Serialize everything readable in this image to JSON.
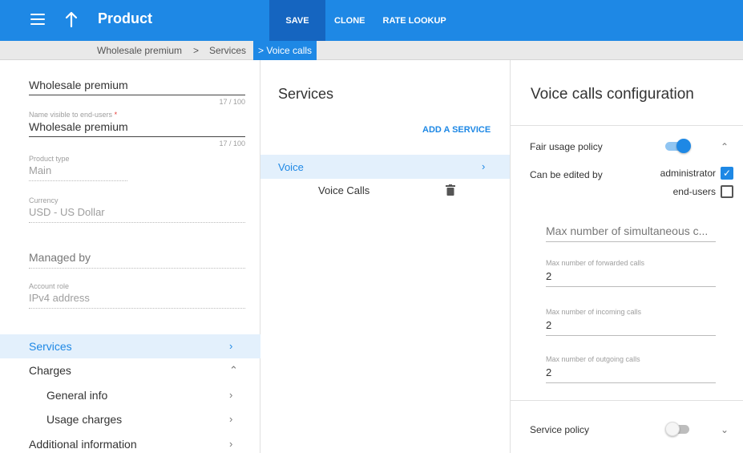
{
  "header": {
    "title": "Product",
    "save_label": "SAVE",
    "clone_label": "CLONE",
    "rate_lookup_label": "RATE LOOKUP"
  },
  "breadcrumb": {
    "items": [
      "Wholesale premium",
      "Services",
      "Voice calls"
    ],
    "separator": ">"
  },
  "product_form": {
    "name": {
      "value": "Wholesale premium",
      "counter": "17 / 100"
    },
    "visible_name": {
      "label": "Name visible to end-users",
      "required_mark": "*",
      "value": "Wholesale premium",
      "counter": "17 / 100"
    },
    "product_type": {
      "label": "Product type",
      "value": "Main"
    },
    "currency": {
      "label": "Currency",
      "value": "USD - US Dollar"
    },
    "managed_by": {
      "value": "Managed by"
    },
    "account_role": {
      "label": "Account role",
      "value": "IPv4 address"
    }
  },
  "nav": {
    "services": "Services",
    "charges": "Charges",
    "general_info": "General info",
    "usage_charges": "Usage charges",
    "additional_information": "Additional information"
  },
  "services_panel": {
    "title": "Services",
    "add_label": "ADD A SERVICE",
    "group": "Voice",
    "item": "Voice Calls"
  },
  "config_panel": {
    "title": "Voice calls configuration",
    "fair_usage_label": "Fair usage policy",
    "fair_usage_enabled": true,
    "can_edit_label": "Can be edited by",
    "roles": [
      {
        "label": "administrator",
        "checked": true
      },
      {
        "label": "end-users",
        "checked": false
      }
    ],
    "max_simultaneous_placeholder": "Max number of simultaneous c...",
    "max_forwarded": {
      "label": "Max number of forwarded calls",
      "value": "2"
    },
    "max_incoming": {
      "label": "Max number of incoming calls",
      "value": "2"
    },
    "max_outgoing": {
      "label": "Max number of outgoing calls",
      "value": "2"
    },
    "service_policy_label": "Service policy",
    "service_policy_enabled": false
  },
  "colors": {
    "accent": "#1e88e5",
    "accent_dark": "#1565c0",
    "selected_bg": "#e3f0fc",
    "required": "#e53935"
  },
  "icons": [
    "menu-icon",
    "arrow-up-icon",
    "chevron-right-icon",
    "chevron-up-icon",
    "chevron-down-icon",
    "trash-icon",
    "check-icon"
  ]
}
